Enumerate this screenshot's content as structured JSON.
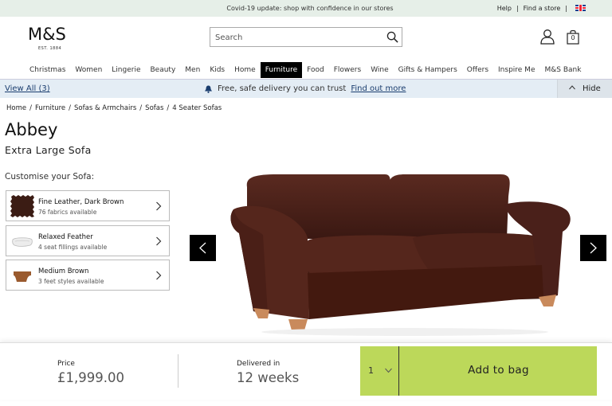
{
  "topbar": {
    "covid_text": "Covid-19 update: shop with confidence in our stores",
    "help": "Help",
    "find_store": "Find a store",
    "sep": "|"
  },
  "header": {
    "logo": "M&S",
    "logo_est": "EST. 1884",
    "search_placeholder": "Search",
    "bag_count": "0"
  },
  "nav": {
    "items": [
      "Christmas",
      "Women",
      "Lingerie",
      "Beauty",
      "Men",
      "Kids",
      "Home",
      "Furniture",
      "Food",
      "Flowers",
      "Wine",
      "Gifts & Hampers",
      "Offers",
      "Inspire Me",
      "M&S Bank"
    ],
    "active": "Furniture"
  },
  "delivery_bar": {
    "view_all": "View All (3)",
    "promo": "Free, safe delivery you can trust",
    "link": "Find out more",
    "hide": "Hide"
  },
  "breadcrumb": [
    "Home",
    "/",
    "Furniture",
    "/",
    "Sofas & Armchairs",
    "/",
    "Sofas",
    "/",
    "4 Seater Sofas"
  ],
  "product": {
    "title": "Abbey",
    "subtitle": "Extra Large Sofa",
    "customise_label": "Customise your Sofa:",
    "options": [
      {
        "name": "Fine Leather, Dark Brown",
        "desc": "76 fabrics available",
        "icon": "fabric-swatch-icon"
      },
      {
        "name": "Relaxed Feather",
        "desc": "4 seat fillings available",
        "icon": "cushion-icon"
      },
      {
        "name": "Medium Brown",
        "desc": "3 feet styles available",
        "icon": "sofa-foot-icon"
      }
    ],
    "colors": {
      "leather": "#4a211a",
      "feet": "#c98a5c"
    }
  },
  "purchase": {
    "price_label": "Price",
    "price": "£1,999.00",
    "delivered_label": "Delivered in",
    "delivered_value": "12 weeks",
    "quantity": "1",
    "add_to_bag": "Add to bag",
    "accent": "#bcd85a"
  }
}
